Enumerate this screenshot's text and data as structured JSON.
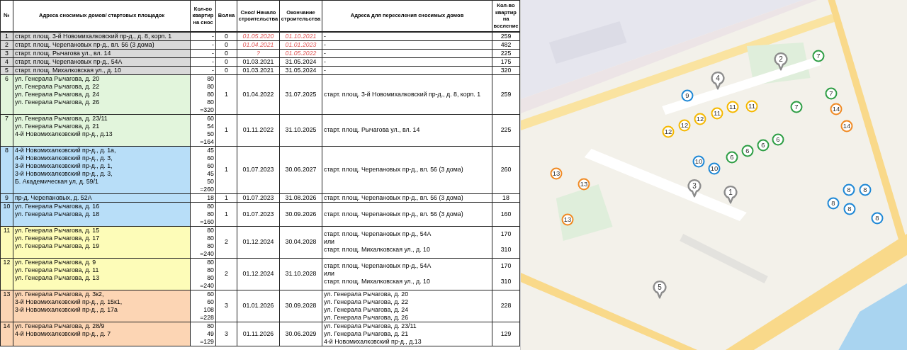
{
  "table": {
    "columns": [
      "№",
      "Адреса сносимых домов/ стартовых площадок",
      "Кол-во квартир на снос",
      "Волна",
      "Снос/ Начало строительства",
      "Окончание строительства",
      "Адреса для переселения сносимых домов",
      "Кол-во квартир на вселение"
    ],
    "rows": [
      {
        "no": "1",
        "color": "#d9d9d9",
        "addresses": [
          "старт. площ. 3-й Новомихалковский пр-д., д. 8, корп. 1"
        ],
        "apartments": [
          "-"
        ],
        "wave": "0",
        "start": "01.05.2020",
        "end": "01.10.2021",
        "red_dates": true,
        "targets": [
          {
            "text": "-"
          }
        ],
        "count": "259"
      },
      {
        "no": "2",
        "color": "#d9d9d9",
        "addresses": [
          "старт. площ. Черепановых пр-д., вл. 56 (3 дома)"
        ],
        "apartments": [
          "-"
        ],
        "wave": "0",
        "start": "01.04.2021",
        "end": "01.01.2023",
        "red_dates": true,
        "targets": [
          {
            "text": "-"
          }
        ],
        "count": "482"
      },
      {
        "no": "3",
        "color": "#d9d9d9",
        "addresses": [
          "старт. площ. Рычагова ул., вл. 14"
        ],
        "apartments": [
          "-"
        ],
        "wave": "0",
        "start": "?",
        "end": "01.05.2022",
        "red_dates": true,
        "targets": [
          {
            "text": "-"
          }
        ],
        "count": "225"
      },
      {
        "no": "4",
        "color": "#d9d9d9",
        "addresses": [
          "старт. площ. Черепановых пр-д., 54А"
        ],
        "apartments": [
          "-"
        ],
        "wave": "0",
        "start": "01.03.2021",
        "end": "31.05.2024",
        "red_dates": false,
        "targets": [
          {
            "text": "-"
          }
        ],
        "count": "175"
      },
      {
        "no": "5",
        "color": "#d9d9d9",
        "addresses": [
          "старт. площ. Михалковская ул., д. 10"
        ],
        "apartments": [
          "-"
        ],
        "wave": "0",
        "start": "01.03.2021",
        "end": "31.05.2024",
        "red_dates": false,
        "targets": [
          {
            "text": "-"
          }
        ],
        "count": "320"
      },
      {
        "no": "6",
        "color": "#e2f5dc",
        "addresses": [
          "ул. Генерала Рычагова, д. 20",
          "ул. Генерала Рычагова, д. 22",
          "ул. Генерала Рычагова, д. 24",
          "ул. Генерала Рычагова, д. 26"
        ],
        "apartments": [
          "80",
          "80",
          "80",
          "80",
          "=320"
        ],
        "wave": "1",
        "start": "01.04.2022",
        "end": "31.07.2025",
        "red_dates": false,
        "targets": [
          {
            "text": "старт. площ. 3-й Новомихалковский пр-д., д. 8, корп. 1"
          }
        ],
        "count": "259"
      },
      {
        "no": "7",
        "color": "#e2f5dc",
        "addresses": [
          "ул. Генерала Рычагова, д. 23/11",
          "ул. Генерала Рычагова, д. 21",
          "4-й Новомихалковский пр-д., д.13"
        ],
        "apartments": [
          "60",
          "54",
          "50",
          "=164"
        ],
        "wave": "1",
        "start": "01.11.2022",
        "end": "31.10.2025",
        "red_dates": false,
        "targets": [
          {
            "text": "старт. площ. Рычагова ул., вл. 14"
          }
        ],
        "count": "225"
      },
      {
        "no": "8",
        "color": "#b8def8",
        "addresses": [
          "4-й Новомихалковский пр-д., д. 1а,",
          "4-й Новомихалковский пр-д., д. 3,",
          "3-й Новомихалковский пр-д., д. 1,",
          "3-й Новомихалковский пр-д., д. 3,",
          "Б. Академическая ул, д. 59/1"
        ],
        "apartments": [
          "45",
          "60",
          "60",
          "45",
          "50",
          "=260"
        ],
        "wave": "1",
        "start": "01.07.2023",
        "end": "30.06.2027",
        "red_dates": false,
        "targets": [
          {
            "text": "старт. площ. Черепановых пр-д., вл. 56 (3 дома)"
          }
        ],
        "count": "260"
      },
      {
        "no": "9",
        "color": "#b8def8",
        "addresses": [
          "пр-д. Черепановых, д. 52А"
        ],
        "apartments": [
          "18"
        ],
        "wave": "1",
        "start": "01.07.2023",
        "end": "31.08.2026",
        "red_dates": false,
        "targets": [
          {
            "text": "старт. площ. Черепановых пр-д., вл. 56 (3 дома)"
          }
        ],
        "count": "18"
      },
      {
        "no": "10",
        "color": "#b8def8",
        "addresses": [
          "ул. Генерала Рычагова, д. 16",
          "ул. Генерала Рычагова, д. 18"
        ],
        "apartments": [
          "80",
          "80",
          "=160"
        ],
        "wave": "1",
        "start": "01.07.2023",
        "end": "30.09.2026",
        "red_dates": false,
        "targets": [
          {
            "text": "старт. площ. Черепановых пр-д., вл. 56 (3 дома)"
          }
        ],
        "count": "160"
      },
      {
        "no": "11",
        "color": "#fdfcb8",
        "addresses": [
          "ул. Генерала Рычагова, д. 15",
          "ул. Генерала Рычагова, д. 17",
          "ул. Генерала Рычагова, д. 19"
        ],
        "apartments": [
          "80",
          "80",
          "80",
          "=240"
        ],
        "wave": "2",
        "start": "01.12.2024",
        "end": "30.04.2028",
        "red_dates": false,
        "targets": [
          {
            "text": "старт. площ. Черепановых пр-д., 54А",
            "count": "170"
          },
          {
            "text": "или"
          },
          {
            "text": "старт. площ. Михалковская ул., д. 10",
            "count": "310"
          }
        ]
      },
      {
        "no": "12",
        "color": "#fdfcb8",
        "addresses": [
          "ул. Генерала Рычагова, д. 9",
          "ул. Генерала Рычагова, д. 11",
          "ул. Генерала Рычагова, д. 13"
        ],
        "apartments": [
          "80",
          "80",
          "80",
          "=240"
        ],
        "wave": "2",
        "start": "01.12.2024",
        "end": "31.10.2028",
        "red_dates": false,
        "targets": [
          {
            "text": "старт. площ. Черепановых пр-д., 54А",
            "count": "170"
          },
          {
            "text": "или"
          },
          {
            "text": "старт. площ. Михалковская ул., д. 10",
            "count": "310"
          }
        ]
      },
      {
        "no": "13",
        "color": "#fcd5b4",
        "addresses": [
          "ул. Генерала Рычагова, д. 3к2,",
          "3-й Новомихалковский пр-д., д. 15к1,",
          "3-й Новомихалковский пр-д., д. 17а"
        ],
        "apartments": [
          "60",
          "60",
          "108",
          "=228"
        ],
        "wave": "3",
        "start": "01.01.2026",
        "end": "30.09.2028",
        "red_dates": false,
        "targets": [
          {
            "text": "ул. Генерала Рычагова, д. 20"
          },
          {
            "text": "ул. Генерала Рычагова, д. 22"
          },
          {
            "text": "ул. Генерала Рычагова, д. 24"
          },
          {
            "text": "ул. Генерала Рычагова, д. 26"
          }
        ],
        "count": "228"
      },
      {
        "no": "14",
        "color": "#fcd5b4",
        "addresses": [
          "ул. Генерала Рычагова, д. 28/9",
          "4-й Новомихалковский пр-д., д. 7"
        ],
        "apartments": [
          "80",
          "49",
          "=129"
        ],
        "wave": "3",
        "start": "01.11.2026",
        "end": "30.06.2029",
        "red_dates": false,
        "targets": [
          {
            "text": "ул. Генерала Рычагова, д. 23/11"
          },
          {
            "text": "ул. Генерала Рычагова, д. 21"
          },
          {
            "text": "4-й Новомихалковский пр-д., д.13"
          }
        ],
        "count": "129"
      }
    ]
  },
  "map": {
    "kind": "picture",
    "markers": [
      {
        "label": "2",
        "kind": "pin",
        "color": "#8c8c8c"
      },
      {
        "label": "7",
        "kind": "circle",
        "color": "#2e9e45"
      },
      {
        "label": "4",
        "kind": "pin",
        "color": "#8c8c8c"
      },
      {
        "label": "9",
        "kind": "circle",
        "color": "#1e88d6"
      },
      {
        "label": "7",
        "kind": "circle",
        "color": "#2e9e45"
      },
      {
        "label": "11",
        "kind": "circle",
        "color": "#f5b800"
      },
      {
        "label": "11",
        "kind": "circle",
        "color": "#f5b800"
      },
      {
        "label": "7",
        "kind": "circle",
        "color": "#2e9e45"
      },
      {
        "label": "14",
        "kind": "circle",
        "color": "#f08a24"
      },
      {
        "label": "11",
        "kind": "circle",
        "color": "#f5b800"
      },
      {
        "label": "12",
        "kind": "circle",
        "color": "#f5b800"
      },
      {
        "label": "12",
        "kind": "circle",
        "color": "#f5b800"
      },
      {
        "label": "14",
        "kind": "circle",
        "color": "#f08a24"
      },
      {
        "label": "12",
        "kind": "circle",
        "color": "#f5b800"
      },
      {
        "label": "6",
        "kind": "circle",
        "color": "#2e9e45"
      },
      {
        "label": "6",
        "kind": "circle",
        "color": "#2e9e45"
      },
      {
        "label": "6",
        "kind": "circle",
        "color": "#2e9e45"
      },
      {
        "label": "6",
        "kind": "circle",
        "color": "#2e9e45"
      },
      {
        "label": "10",
        "kind": "circle",
        "color": "#1e88d6"
      },
      {
        "label": "10",
        "kind": "circle",
        "color": "#1e88d6"
      },
      {
        "label": "13",
        "kind": "circle",
        "color": "#f08a24"
      },
      {
        "label": "3",
        "kind": "pin",
        "color": "#8c8c8c"
      },
      {
        "label": "13",
        "kind": "circle",
        "color": "#f08a24"
      },
      {
        "label": "1",
        "kind": "pin",
        "color": "#8c8c8c"
      },
      {
        "label": "8",
        "kind": "circle",
        "color": "#1e88d6"
      },
      {
        "label": "8",
        "kind": "circle",
        "color": "#1e88d6"
      },
      {
        "label": "8",
        "kind": "circle",
        "color": "#1e88d6"
      },
      {
        "label": "8",
        "kind": "circle",
        "color": "#1e88d6"
      },
      {
        "label": "8",
        "kind": "circle",
        "color": "#1e88d6"
      },
      {
        "label": "13",
        "kind": "circle",
        "color": "#f08a24"
      },
      {
        "label": "5",
        "kind": "pin",
        "color": "#8c8c8c"
      }
    ]
  }
}
